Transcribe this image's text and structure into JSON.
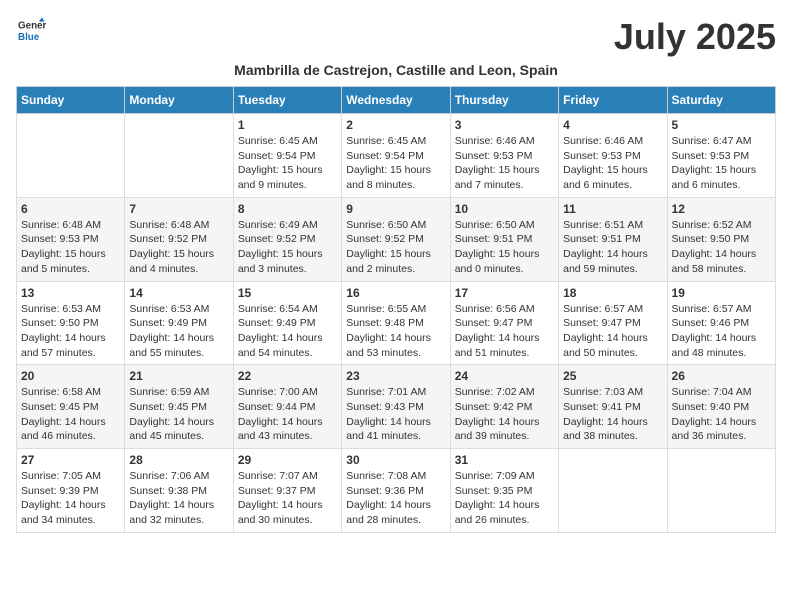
{
  "logo": {
    "line1": "General",
    "line2": "Blue"
  },
  "title": "July 2025",
  "subtitle": "Mambrilla de Castrejon, Castille and Leon, Spain",
  "days_of_week": [
    "Sunday",
    "Monday",
    "Tuesday",
    "Wednesday",
    "Thursday",
    "Friday",
    "Saturday"
  ],
  "weeks": [
    [
      {
        "day": "",
        "info": ""
      },
      {
        "day": "",
        "info": ""
      },
      {
        "day": "1",
        "info": "Sunrise: 6:45 AM\nSunset: 9:54 PM\nDaylight: 15 hours and 9 minutes."
      },
      {
        "day": "2",
        "info": "Sunrise: 6:45 AM\nSunset: 9:54 PM\nDaylight: 15 hours and 8 minutes."
      },
      {
        "day": "3",
        "info": "Sunrise: 6:46 AM\nSunset: 9:53 PM\nDaylight: 15 hours and 7 minutes."
      },
      {
        "day": "4",
        "info": "Sunrise: 6:46 AM\nSunset: 9:53 PM\nDaylight: 15 hours and 6 minutes."
      },
      {
        "day": "5",
        "info": "Sunrise: 6:47 AM\nSunset: 9:53 PM\nDaylight: 15 hours and 6 minutes."
      }
    ],
    [
      {
        "day": "6",
        "info": "Sunrise: 6:48 AM\nSunset: 9:53 PM\nDaylight: 15 hours and 5 minutes."
      },
      {
        "day": "7",
        "info": "Sunrise: 6:48 AM\nSunset: 9:52 PM\nDaylight: 15 hours and 4 minutes."
      },
      {
        "day": "8",
        "info": "Sunrise: 6:49 AM\nSunset: 9:52 PM\nDaylight: 15 hours and 3 minutes."
      },
      {
        "day": "9",
        "info": "Sunrise: 6:50 AM\nSunset: 9:52 PM\nDaylight: 15 hours and 2 minutes."
      },
      {
        "day": "10",
        "info": "Sunrise: 6:50 AM\nSunset: 9:51 PM\nDaylight: 15 hours and 0 minutes."
      },
      {
        "day": "11",
        "info": "Sunrise: 6:51 AM\nSunset: 9:51 PM\nDaylight: 14 hours and 59 minutes."
      },
      {
        "day": "12",
        "info": "Sunrise: 6:52 AM\nSunset: 9:50 PM\nDaylight: 14 hours and 58 minutes."
      }
    ],
    [
      {
        "day": "13",
        "info": "Sunrise: 6:53 AM\nSunset: 9:50 PM\nDaylight: 14 hours and 57 minutes."
      },
      {
        "day": "14",
        "info": "Sunrise: 6:53 AM\nSunset: 9:49 PM\nDaylight: 14 hours and 55 minutes."
      },
      {
        "day": "15",
        "info": "Sunrise: 6:54 AM\nSunset: 9:49 PM\nDaylight: 14 hours and 54 minutes."
      },
      {
        "day": "16",
        "info": "Sunrise: 6:55 AM\nSunset: 9:48 PM\nDaylight: 14 hours and 53 minutes."
      },
      {
        "day": "17",
        "info": "Sunrise: 6:56 AM\nSunset: 9:47 PM\nDaylight: 14 hours and 51 minutes."
      },
      {
        "day": "18",
        "info": "Sunrise: 6:57 AM\nSunset: 9:47 PM\nDaylight: 14 hours and 50 minutes."
      },
      {
        "day": "19",
        "info": "Sunrise: 6:57 AM\nSunset: 9:46 PM\nDaylight: 14 hours and 48 minutes."
      }
    ],
    [
      {
        "day": "20",
        "info": "Sunrise: 6:58 AM\nSunset: 9:45 PM\nDaylight: 14 hours and 46 minutes."
      },
      {
        "day": "21",
        "info": "Sunrise: 6:59 AM\nSunset: 9:45 PM\nDaylight: 14 hours and 45 minutes."
      },
      {
        "day": "22",
        "info": "Sunrise: 7:00 AM\nSunset: 9:44 PM\nDaylight: 14 hours and 43 minutes."
      },
      {
        "day": "23",
        "info": "Sunrise: 7:01 AM\nSunset: 9:43 PM\nDaylight: 14 hours and 41 minutes."
      },
      {
        "day": "24",
        "info": "Sunrise: 7:02 AM\nSunset: 9:42 PM\nDaylight: 14 hours and 39 minutes."
      },
      {
        "day": "25",
        "info": "Sunrise: 7:03 AM\nSunset: 9:41 PM\nDaylight: 14 hours and 38 minutes."
      },
      {
        "day": "26",
        "info": "Sunrise: 7:04 AM\nSunset: 9:40 PM\nDaylight: 14 hours and 36 minutes."
      }
    ],
    [
      {
        "day": "27",
        "info": "Sunrise: 7:05 AM\nSunset: 9:39 PM\nDaylight: 14 hours and 34 minutes."
      },
      {
        "day": "28",
        "info": "Sunrise: 7:06 AM\nSunset: 9:38 PM\nDaylight: 14 hours and 32 minutes."
      },
      {
        "day": "29",
        "info": "Sunrise: 7:07 AM\nSunset: 9:37 PM\nDaylight: 14 hours and 30 minutes."
      },
      {
        "day": "30",
        "info": "Sunrise: 7:08 AM\nSunset: 9:36 PM\nDaylight: 14 hours and 28 minutes."
      },
      {
        "day": "31",
        "info": "Sunrise: 7:09 AM\nSunset: 9:35 PM\nDaylight: 14 hours and 26 minutes."
      },
      {
        "day": "",
        "info": ""
      },
      {
        "day": "",
        "info": ""
      }
    ]
  ]
}
